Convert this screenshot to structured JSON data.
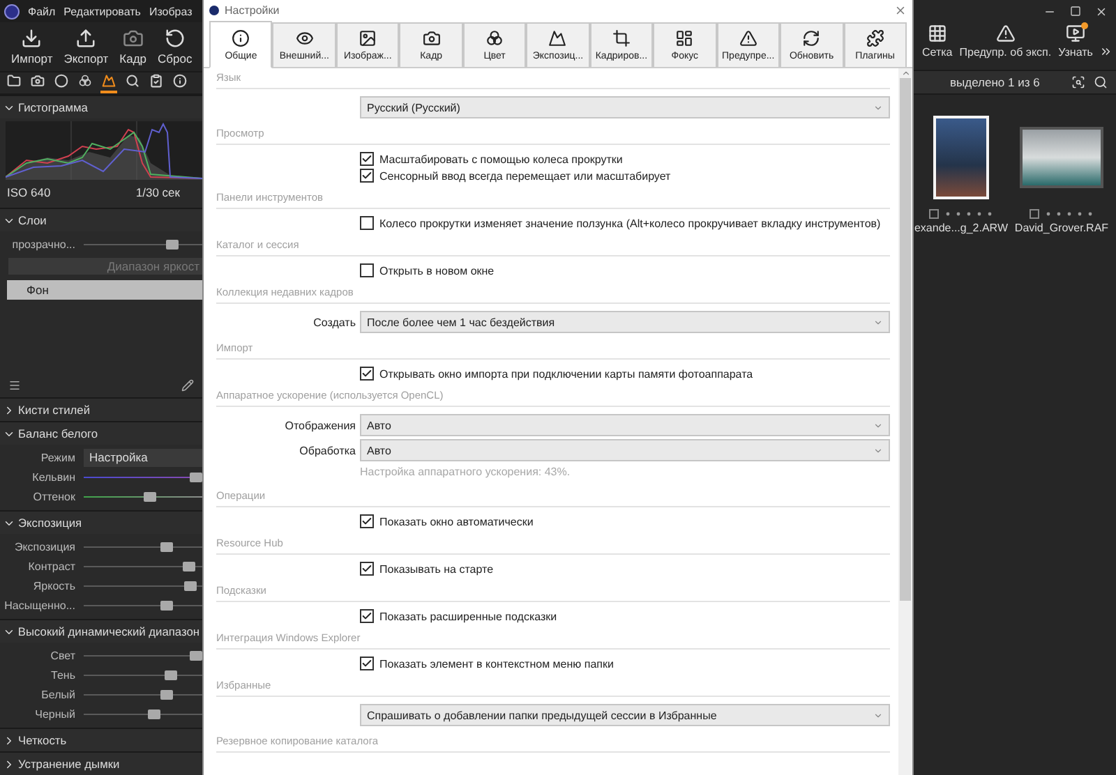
{
  "app_menu": [
    "Файл",
    "Редактировать",
    "Изобраз"
  ],
  "app_toolbar": [
    "Импорт",
    "Экспорт",
    "Кадр",
    "Сброс"
  ],
  "tool_tabs": [
    {
      "selected": false
    },
    {
      "selected": false
    },
    {
      "selected": false
    },
    {
      "selected": false
    },
    {
      "selected": true
    },
    {
      "selected": false
    },
    {
      "selected": false
    },
    {
      "selected": false
    }
  ],
  "left_panel": {
    "sections": [
      {
        "title": "Гистограмма",
        "expanded": true,
        "kind": "histogram",
        "iso": "ISO 640",
        "shutter": "1/30 сек"
      },
      {
        "title": "Слои",
        "expanded": true,
        "kind": "layers",
        "opacity": {
          "label": "прозрачно...",
          "level": 0.78
        },
        "range_button": "Диапазон яркост",
        "layers": [
          {
            "name": "Фон",
            "selected": true
          }
        ]
      },
      {
        "title": "Кисти стилей",
        "expanded": false,
        "kind": "controls"
      },
      {
        "title": "Баланс белого",
        "expanded": true,
        "kind": "controls",
        "rows": [
          {
            "kind": "select",
            "label": "Режим",
            "value": "Настройка"
          },
          {
            "kind": "kelvin",
            "label": "Кельвин",
            "level": 1
          },
          {
            "kind": "tint",
            "label": "Оттенок",
            "level": 0.56
          }
        ]
      },
      {
        "title": "Экспозиция",
        "expanded": true,
        "kind": "controls",
        "rows": [
          {
            "kind": "slider",
            "label": "Экспозиция",
            "level": 0.73
          },
          {
            "kind": "slider",
            "label": "Контраст",
            "level": 0.93
          },
          {
            "kind": "slider",
            "label": "Яркость",
            "level": 0.95
          },
          {
            "kind": "slider",
            "label": "Насыщенно...",
            "level": 0.73
          }
        ]
      },
      {
        "title": "Высокий динамический диапазон",
        "expanded": true,
        "kind": "controls",
        "rows": [
          {
            "kind": "slider",
            "label": "Свет",
            "level": 1
          },
          {
            "kind": "slider",
            "label": "Тень",
            "level": 0.76
          },
          {
            "kind": "slider",
            "label": "Белый",
            "level": 0.73
          },
          {
            "kind": "slider",
            "label": "Черный",
            "level": 0.61
          }
        ]
      },
      {
        "title": "Четкость",
        "expanded": false,
        "kind": "controls"
      },
      {
        "title": "Устранение дымки",
        "expanded": false,
        "kind": "controls"
      }
    ]
  },
  "dialog": {
    "title": "Настройки",
    "tabs": [
      {
        "label": "Общие",
        "selected": true
      },
      {
        "label": "Внешний...",
        "selected": false
      },
      {
        "label": "Изображ...",
        "selected": false
      },
      {
        "label": "Кадр",
        "selected": false
      },
      {
        "label": "Цвет",
        "selected": false
      },
      {
        "label": "Экспозиц...",
        "selected": false
      },
      {
        "label": "Кадриров...",
        "selected": false
      },
      {
        "label": "Фокус",
        "selected": false
      },
      {
        "label": "Предупре...",
        "selected": false
      },
      {
        "label": "Обновить",
        "selected": false
      },
      {
        "label": "Плагины",
        "selected": false
      }
    ],
    "sections": [
      {
        "title": "Язык",
        "rows": [
          {
            "kind": "select",
            "value": "Русский (Русский)"
          }
        ]
      },
      {
        "title": "Просмотр",
        "rows": [
          {
            "kind": "checkbox",
            "label": "Масштабировать с помощью колеса прокрутки",
            "checked": true
          },
          {
            "kind": "checkbox",
            "label": "Сенсорный ввод всегда перемещает или масштабирует",
            "checked": true
          }
        ]
      },
      {
        "title": "Панели инструментов",
        "rows": [
          {
            "kind": "checkbox",
            "label": "Колесо прокрутки изменяет значение ползунка (Alt+колесо прокручивает вкладку инструментов)",
            "checked": false
          }
        ]
      },
      {
        "title": "Каталог и сессия",
        "rows": [
          {
            "kind": "checkbox",
            "label": "Открыть в новом окне",
            "checked": false
          }
        ]
      },
      {
        "title": "Коллекция недавних кадров",
        "rows": [
          {
            "kind": "select",
            "label": "Создать",
            "value": "После более чем 1 час бездействия"
          }
        ]
      },
      {
        "title": "Импорт",
        "rows": [
          {
            "kind": "checkbox",
            "label": "Открывать окно импорта при подключении карты памяти фотоаппарата",
            "checked": true
          }
        ]
      },
      {
        "title": "Аппаратное ускорение (используется OpenCL)",
        "rows": [
          {
            "kind": "select",
            "label": "Отображения",
            "value": "Авто"
          },
          {
            "kind": "select",
            "label": "Обработка",
            "value": "Авто"
          },
          {
            "kind": "note",
            "text": "Настройка аппаратного ускорения: 43%."
          }
        ]
      },
      {
        "title": "Операции",
        "rows": [
          {
            "kind": "checkbox",
            "label": "Показать окно автоматически",
            "checked": true
          }
        ]
      },
      {
        "title": "Resource Hub",
        "rows": [
          {
            "kind": "checkbox",
            "label": "Показывать на старте",
            "checked": true
          }
        ]
      },
      {
        "title": "Подсказки",
        "rows": [
          {
            "kind": "checkbox",
            "label": "Показать расширенные подсказки",
            "checked": true
          }
        ]
      },
      {
        "title": "Интеграция Windows Explorer",
        "rows": [
          {
            "kind": "checkbox",
            "label": "Показать элемент в контекстном меню папки",
            "checked": true
          }
        ]
      },
      {
        "title": "Избранные",
        "rows": [
          {
            "kind": "select",
            "value": "Спрашивать о добавлении папки предыдущей сессии в Избранные"
          }
        ]
      },
      {
        "title": "Резервное копирование каталога"
      }
    ]
  },
  "view_toolbar": [
    "Сетка",
    "Предупр. об эксп.",
    "Узнать"
  ],
  "selection_status": "выделено 1 из 6",
  "thumbnails": [
    {
      "name": "exande...g_2.ARW",
      "selected": true,
      "checked": false
    },
    {
      "name": "David_Grover.RAF",
      "selected": false,
      "checked": false
    }
  ]
}
